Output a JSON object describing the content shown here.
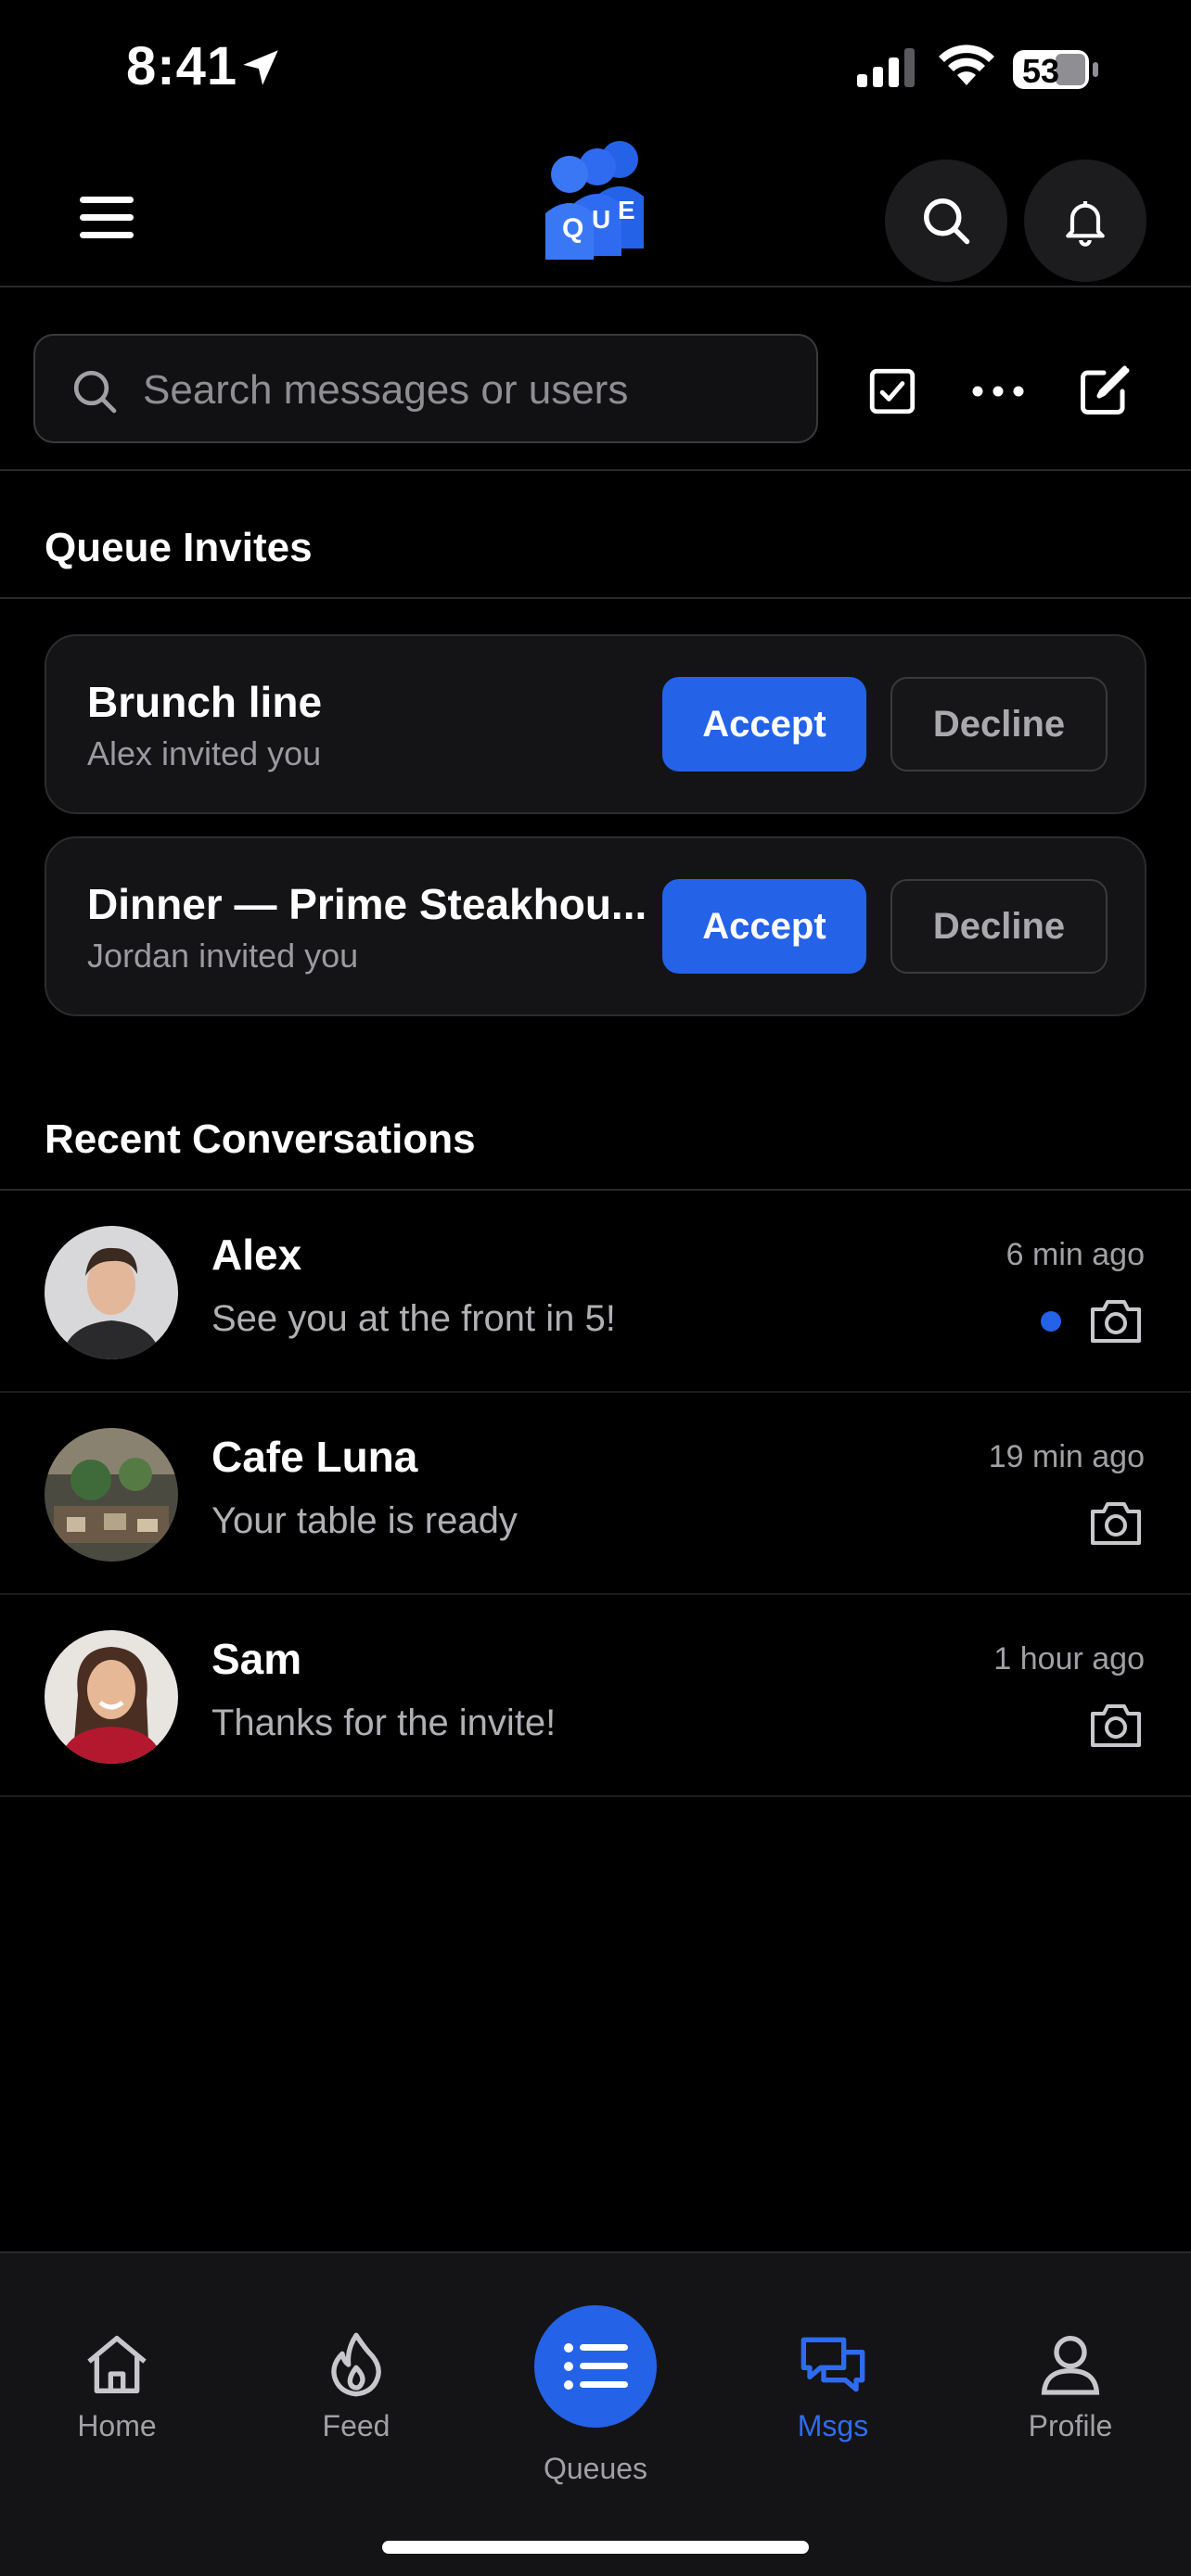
{
  "status_bar": {
    "time": "8:41",
    "battery": "53"
  },
  "header": {
    "logo_letters": [
      "Q",
      "U",
      "E"
    ]
  },
  "search": {
    "placeholder": "Search messages or users"
  },
  "queue_invites": {
    "title": "Queue Invites",
    "items": [
      {
        "title": "Brunch line",
        "subtitle": "Alex invited you",
        "accept": "Accept",
        "decline": "Decline"
      },
      {
        "title": "Dinner — Prime Steakhou...",
        "subtitle": "Jordan invited you",
        "accept": "Accept",
        "decline": "Decline"
      }
    ]
  },
  "recent": {
    "title": "Recent Conversations",
    "items": [
      {
        "name": "Alex",
        "message": "See you at the front in 5!",
        "time": "6 min ago",
        "unread": true
      },
      {
        "name": "Cafe Luna",
        "message": "Your table is ready",
        "time": "19 min ago",
        "unread": false
      },
      {
        "name": "Sam",
        "message": "Thanks for the invite!",
        "time": "1 hour ago",
        "unread": false
      }
    ]
  },
  "nav": {
    "home": "Home",
    "feed": "Feed",
    "queues": "Queues",
    "msgs": "Msgs",
    "profile": "Profile"
  },
  "colors": {
    "accent": "#2462e8",
    "background": "#000000",
    "card": "#141416"
  }
}
